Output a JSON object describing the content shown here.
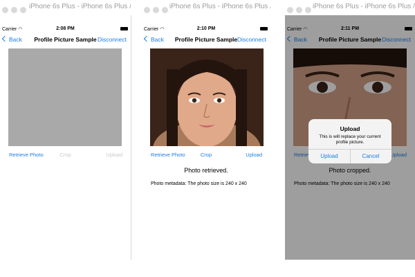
{
  "window_title": "iPhone 6s Plus - iPhone 6s Plus / iO...",
  "carrier": "Carrier",
  "nav": {
    "back": "Back",
    "title": "Profile Picture Sample",
    "disconnect": "Disconnect"
  },
  "toolbar": {
    "retrieve": "Retrieve Photo",
    "crop": "Crop",
    "upload": "Upload"
  },
  "screens": [
    {
      "time": "2:08 PM",
      "status": "",
      "metadata": "",
      "crop_enabled": false,
      "upload_enabled": false
    },
    {
      "time": "2:10 PM",
      "status": "Photo retrieved.",
      "metadata": "Photo metadata: The photo size is 240 x 240",
      "crop_enabled": true,
      "upload_enabled": true
    },
    {
      "time": "2:11 PM",
      "status": "Photo cropped.",
      "metadata": "Photo metadata: The photo size is 240 x 240",
      "crop_enabled": true,
      "upload_enabled": true
    }
  ],
  "alert": {
    "title": "Upload",
    "message": "This is will replace your current profile picture.",
    "confirm": "Upload",
    "cancel": "Cancel"
  },
  "colors": {
    "ios_blue": "#1a7ee8",
    "placeholder_gray": "#a9a9a9",
    "disabled_gray": "#c7c7c7"
  },
  "icons": [
    "wifi-icon",
    "battery-icon",
    "chevron-left-icon"
  ]
}
